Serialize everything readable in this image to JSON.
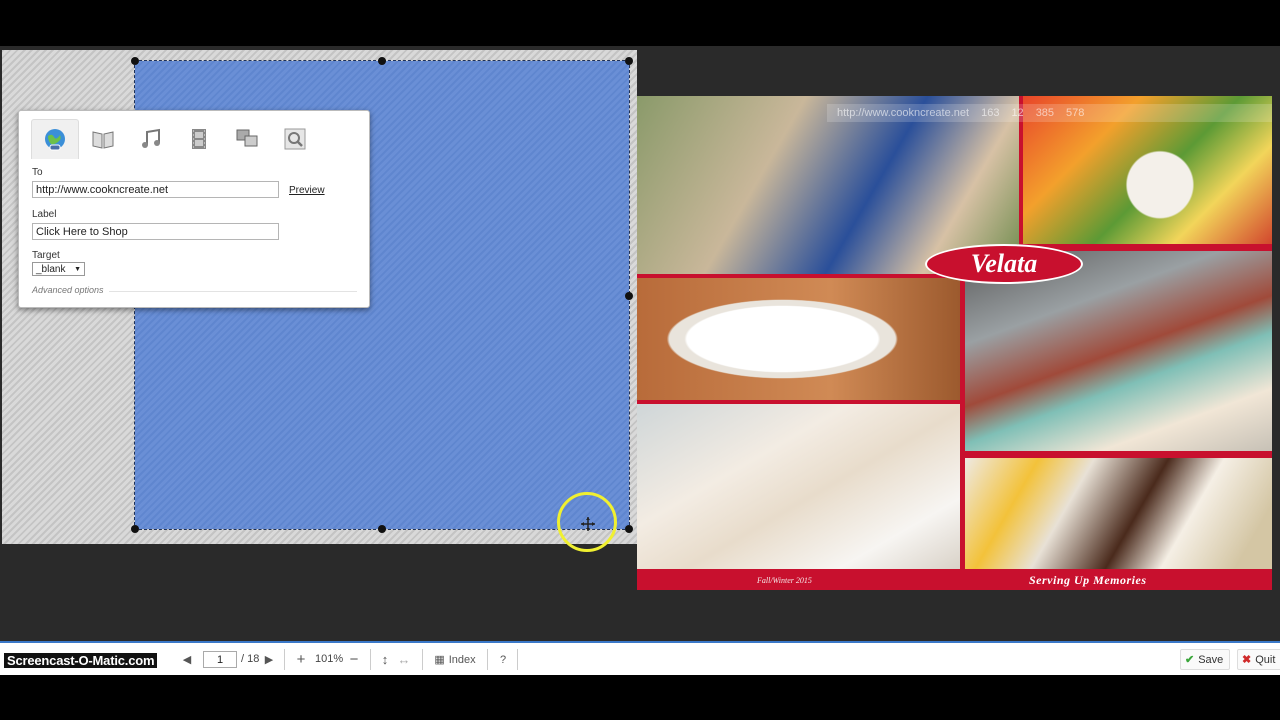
{
  "dialog": {
    "tabs": [
      {
        "name": "globe-link-icon"
      },
      {
        "name": "book-icon"
      },
      {
        "name": "music-icon"
      },
      {
        "name": "film-icon"
      },
      {
        "name": "pages-icon"
      },
      {
        "name": "magnify-icon"
      }
    ],
    "to_label": "To",
    "to_value": "http://www.cooknсreate.net",
    "preview_label": "Preview",
    "label_label": "Label",
    "label_value": "Click Here to Shop",
    "target_label": "Target",
    "target_value": "_blank",
    "advanced_label": "Advanced options"
  },
  "catalog": {
    "brand": "Velata",
    "footer_left": "Fall/Winter 2015",
    "footer_right": "Serving Up Memories",
    "overlay": {
      "url": "http://www.cooknсreate.net",
      "v1": "163",
      "v2": "12",
      "v3": "385",
      "v4": "578"
    }
  },
  "statusbar": {
    "watermark": "Screencast-O-Matic.com",
    "page_current": "1",
    "page_total": "/ 18",
    "zoom": "101%",
    "index_label": "Index",
    "help_label": "?",
    "save_label": "Save",
    "quit_label": "Quit"
  },
  "colors": {
    "link_area": "#6a8fd6",
    "brand_red": "#c8102e",
    "accent_blue": "#3a78c8",
    "save_green": "#3aa63a",
    "quit_red": "#d02a2a"
  }
}
